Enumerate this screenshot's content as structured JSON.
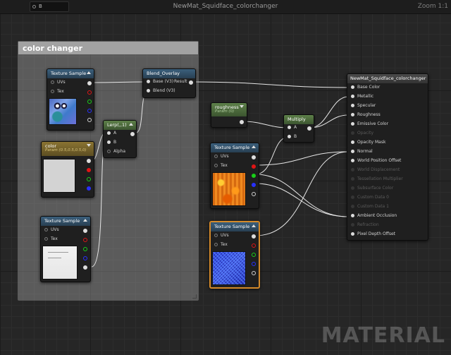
{
  "toolbar": {
    "dropdown_value": "B",
    "title": "NewMat_Squidface_colorchanger",
    "zoom": "Zoom 1:1"
  },
  "comment": {
    "title": "color changer"
  },
  "nodes": {
    "tex_top": {
      "title": "Texture Sample",
      "pins": [
        "UVs",
        "Tex"
      ]
    },
    "color": {
      "title": "color",
      "subtitle": "Param (0.5,0.5,0.5,0)"
    },
    "tex_bottom": {
      "title": "Texture Sample",
      "pins": [
        "UVs",
        "Tex"
      ]
    },
    "lerp": {
      "title": "Lerp(,,1)",
      "pins": [
        "A",
        "B",
        "Alpha"
      ]
    },
    "blend": {
      "title": "Blend_Overlay",
      "pins": [
        "Base (V3)",
        "Blend (V3)"
      ],
      "output": "Result"
    },
    "roughness": {
      "title": "roughness",
      "subtitle": "Param (0)"
    },
    "multiply": {
      "title": "Multiply",
      "pins": [
        "A",
        "B"
      ]
    },
    "tex_orange": {
      "title": "Texture Sample",
      "pins": [
        "UVs",
        "Tex"
      ]
    },
    "tex_noise": {
      "title": "Texture Sample",
      "pins": [
        "UVs",
        "Tex"
      ]
    },
    "material": {
      "title": "NewMat_Squidface_colorchanger",
      "inputs": [
        {
          "label": "Base Color",
          "active": true
        },
        {
          "label": "Metallic",
          "active": true
        },
        {
          "label": "Specular",
          "active": true
        },
        {
          "label": "Roughness",
          "active": true
        },
        {
          "label": "Emissive Color",
          "active": true
        },
        {
          "label": "Opacity",
          "active": false
        },
        {
          "label": "Opacity Mask",
          "active": true
        },
        {
          "label": "Normal",
          "active": true
        },
        {
          "label": "World Position Offset",
          "active": true
        },
        {
          "label": "World Displacement",
          "active": false
        },
        {
          "label": "Tessellation Multiplier",
          "active": false
        },
        {
          "label": "Subsurface Color",
          "active": false
        },
        {
          "label": "Custom Data 0",
          "active": false
        },
        {
          "label": "Custom Data 1",
          "active": false
        },
        {
          "label": "Ambient Occlusion",
          "active": true
        },
        {
          "label": "Refraction",
          "active": false
        },
        {
          "label": "Pixel Depth Offset",
          "active": true
        }
      ]
    }
  },
  "watermark": "MATERIAL",
  "colors": {
    "selected_border": "#d58a2a",
    "wire": "#e6e6e6",
    "canvas": "#262626"
  }
}
